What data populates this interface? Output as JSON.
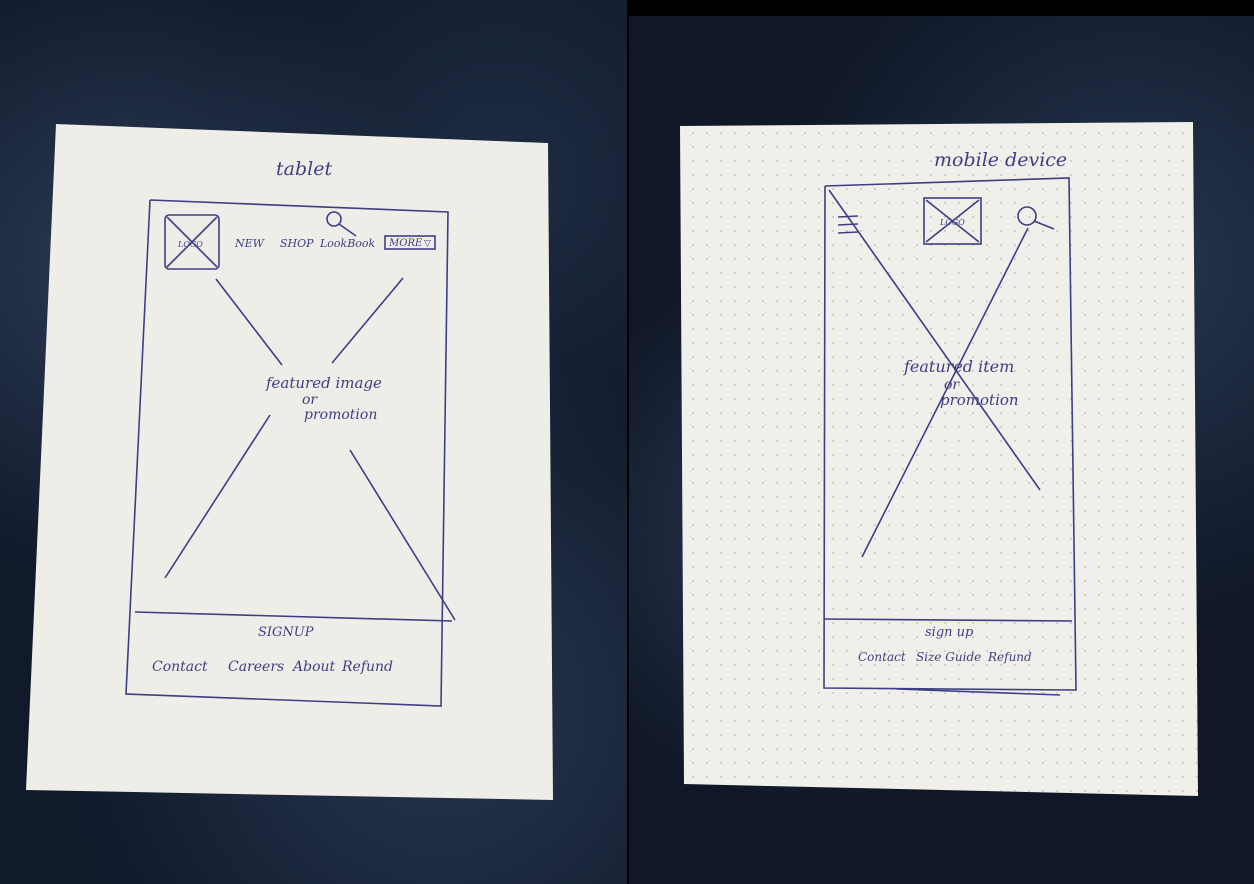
{
  "tablet": {
    "title": "tablet",
    "logo": "LOGO",
    "nav": [
      "NEW",
      "SHOP",
      "LookBook"
    ],
    "more": "MORE",
    "hero": [
      "featured image",
      "or",
      "promotion"
    ],
    "footer_signup": "SIGNUP",
    "footer_links": [
      "Contact",
      "Careers",
      "About",
      "Refund"
    ]
  },
  "mobile": {
    "title": "mobile device",
    "logo": "LOGO",
    "hero": [
      "featured item",
      "or",
      "promotion"
    ],
    "footer_signup": "sign up",
    "footer_links": [
      "Contact",
      "Size Guide",
      "Refund"
    ]
  },
  "colors": {
    "ink": "#3d3f86",
    "paper": "#f1efe9"
  }
}
